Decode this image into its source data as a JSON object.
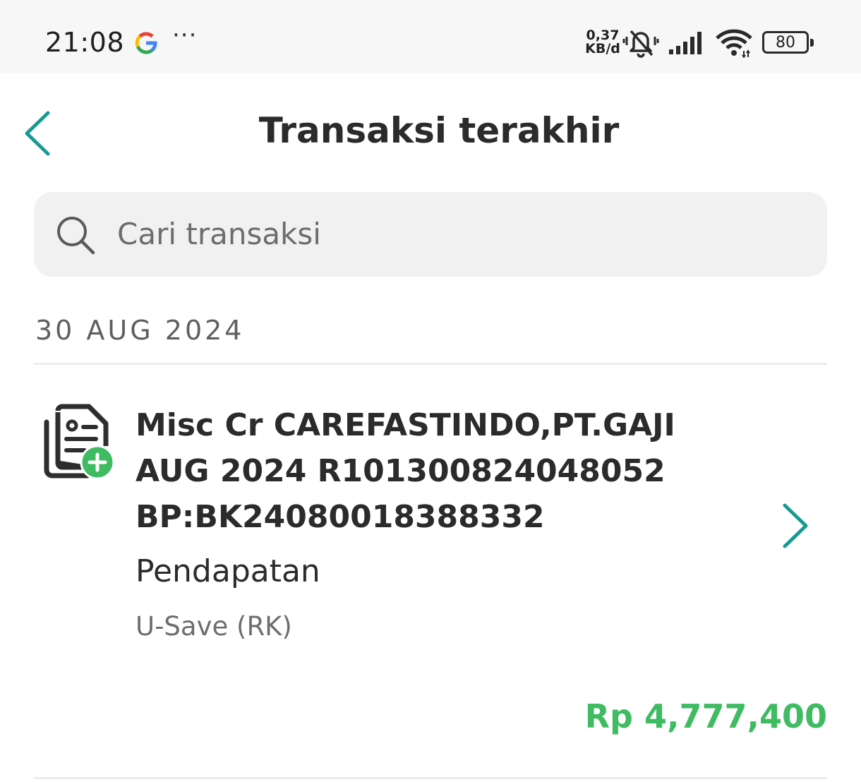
{
  "status_bar": {
    "time": "21:08",
    "net_speed_value": "0,37",
    "net_speed_unit": "KB/d",
    "battery": "80",
    "icons": [
      "google-icon",
      "more-dots-icon",
      "muted-bell-icon",
      "signal-icon",
      "wifi-icon",
      "battery-icon"
    ]
  },
  "header": {
    "title": "Transaksi terakhir",
    "back_icon": "chevron-left-icon"
  },
  "search": {
    "placeholder": "Cari transaksi",
    "value": "",
    "icon": "search-icon"
  },
  "groups": [
    {
      "date": "30 AUG 2024",
      "transactions": [
        {
          "title_lines": [
            "Misc Cr CAREFASTINDO,PT.GAJI",
            "AUG 2024 R101300824048052",
            "BP:BK24080018388332"
          ],
          "category": "Pendapatan",
          "account": "U-Save (RK)",
          "amount": "Rp 4,777,400",
          "icon": "document-income-icon"
        }
      ]
    }
  ],
  "colors": {
    "accent": "#169a93",
    "income": "#3fbb62",
    "text": "#2b2b2b",
    "muted": "#6d6d6d",
    "search_bg": "#f1f1f1"
  }
}
